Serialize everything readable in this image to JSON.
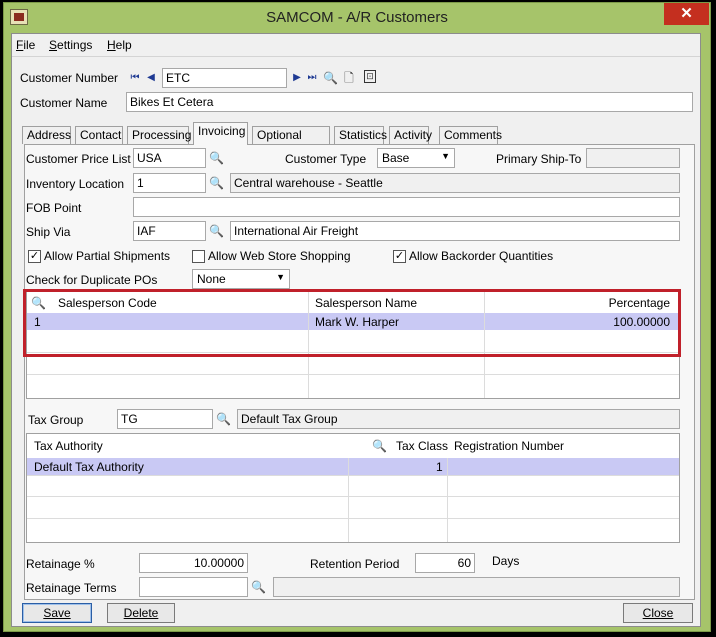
{
  "window": {
    "title": "SAMCOM - A/R Customers",
    "close_glyph": "✕"
  },
  "menu": [
    {
      "underline": "F",
      "rest": "ile"
    },
    {
      "underline": "S",
      "rest": "ettings"
    },
    {
      "underline": "H",
      "rest": "elp"
    }
  ],
  "header": {
    "customer_number_label": "Customer Number",
    "customer_number": "ETC",
    "customer_name_label": "Customer Name",
    "customer_name": "Bikes Et Cetera"
  },
  "tabs": [
    "Address",
    "Contact",
    "Processing",
    "Invoicing",
    "Optional Fields",
    "Statistics",
    "Activity",
    "Comments"
  ],
  "active_tab": "Invoicing",
  "invoicing": {
    "customer_price_list_label": "Customer Price List",
    "customer_price_list": "USA",
    "customer_type_label": "Customer Type",
    "customer_type": "Base",
    "primary_ship_to_label": "Primary Ship-To",
    "primary_ship_to": "",
    "inventory_location_label": "Inventory Location",
    "inventory_location": "1",
    "inventory_location_desc": "Central warehouse - Seattle",
    "fob_point_label": "FOB Point",
    "fob_point": "",
    "ship_via_label": "Ship Via",
    "ship_via": "IAF",
    "ship_via_desc": "International Air Freight",
    "allow_partial_label": "Allow Partial Shipments",
    "allow_partial": true,
    "allow_web_label": "Allow Web Store Shopping",
    "allow_web": false,
    "allow_backorder_label": "Allow Backorder Quantities",
    "allow_backorder": true,
    "dup_po_label": "Check for Duplicate POs",
    "dup_po": "None",
    "salesperson_grid": {
      "headers": [
        "Salesperson Code",
        "Salesperson Name",
        "Percentage"
      ],
      "rows": [
        {
          "code": "1",
          "name": "Mark W. Harper",
          "percentage": "100.00000"
        }
      ]
    },
    "tax_group_label": "Tax Group",
    "tax_group": "TG",
    "tax_group_desc": "Default Tax Group",
    "tax_grid": {
      "headers": [
        "Tax Authority",
        "Tax Class",
        "Registration Number"
      ],
      "rows": [
        {
          "authority": "Default Tax Authority",
          "class": "1",
          "registration": ""
        }
      ]
    },
    "retainage_pct_label": "Retainage %",
    "retainage_pct": "10.00000",
    "retention_period_label": "Retention Period",
    "retention_period": "60",
    "days_label": "Days",
    "retainage_terms_label": "Retainage Terms",
    "retainage_terms": "",
    "retainage_terms_desc": ""
  },
  "buttons": {
    "save": "Save",
    "delete": "Delete",
    "close": "Close"
  },
  "colors": {
    "title_bar": "#a6c46a",
    "selected_row": "#c9c9f4",
    "highlight_box": "#c0202a",
    "close_button": "#c42f1f"
  }
}
